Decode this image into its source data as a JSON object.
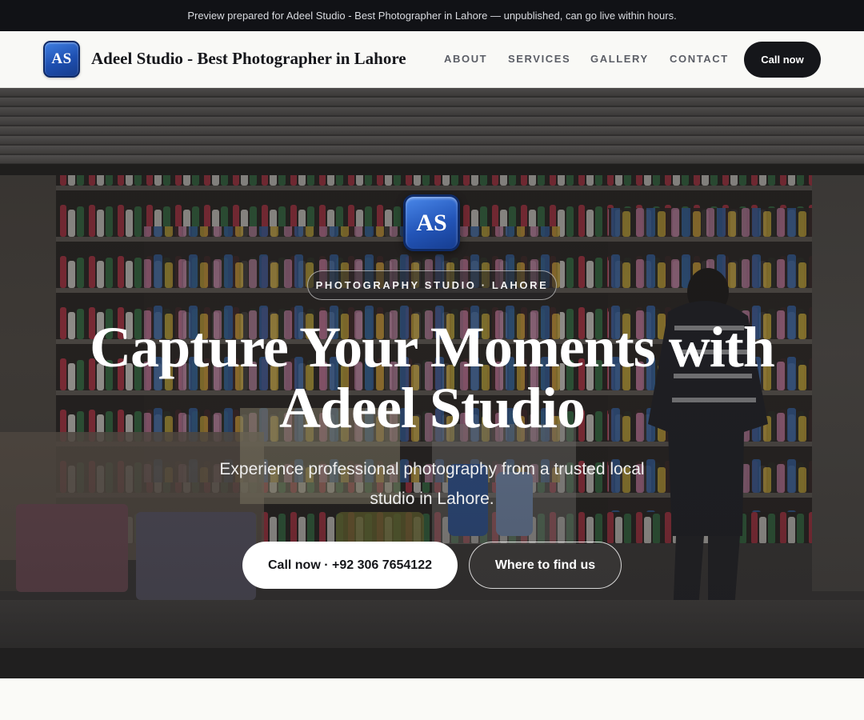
{
  "preview_bar": {
    "text": "Preview prepared for Adeel Studio - Best Photographer in Lahore — unpublished, can go live within hours."
  },
  "header": {
    "logo_text": "AS",
    "brand_name": "Adeel Studio - Best Photographer in Lahore",
    "nav": [
      {
        "label": "ABOUT"
      },
      {
        "label": "SERVICES"
      },
      {
        "label": "GALLERY"
      },
      {
        "label": "CONTACT"
      }
    ],
    "cta_label": "Call now"
  },
  "hero": {
    "logo_text": "AS",
    "tagline": "PHOTOGRAPHY STUDIO · LAHORE",
    "title_line1": "Capture Your Moments with",
    "title_line2": "Adeel Studio",
    "subtitle_line1": "Experience professional photography from a trusted local",
    "subtitle_line2": "studio in Lahore.",
    "primary_button": "Call now · +92 306 7654122",
    "secondary_button": "Where to find us"
  },
  "colors": {
    "accent_dark": "#15161a",
    "logo_blue": "#2355b8",
    "preview_bar_bg": "#111216"
  }
}
